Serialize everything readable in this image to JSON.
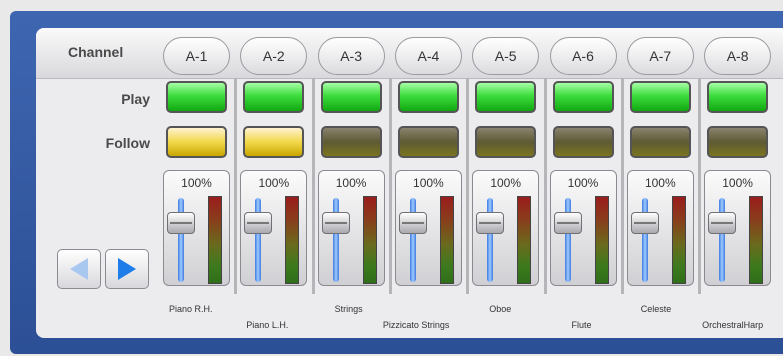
{
  "labels": {
    "channel": "Channel",
    "play": "Play",
    "follow": "Follow"
  },
  "fader_label": "100%",
  "channels": [
    {
      "name": "A-1",
      "instrument": "Piano R.H.",
      "follow_on": true,
      "volume_pct": 100
    },
    {
      "name": "A-2",
      "instrument": "Piano L.H.",
      "follow_on": true,
      "volume_pct": 100
    },
    {
      "name": "A-3",
      "instrument": "Strings",
      "follow_on": false,
      "volume_pct": 100
    },
    {
      "name": "A-4",
      "instrument": "Pizzicato Strings",
      "follow_on": false,
      "volume_pct": 100
    },
    {
      "name": "A-5",
      "instrument": "Oboe",
      "follow_on": false,
      "volume_pct": 100
    },
    {
      "name": "A-6",
      "instrument": "Flute",
      "follow_on": false,
      "volume_pct": 100
    },
    {
      "name": "A-7",
      "instrument": "Celeste",
      "follow_on": false,
      "volume_pct": 100
    },
    {
      "name": "A-8",
      "instrument": "OrchestralHarp",
      "follow_on": false,
      "volume_pct": 100
    }
  ],
  "colors": {
    "frame": "#345aa4",
    "play_on": "#2ecc2e",
    "follow_on": "#f2d84a",
    "follow_off": "#6b6530",
    "nav_arrow": "#1e7de8"
  }
}
